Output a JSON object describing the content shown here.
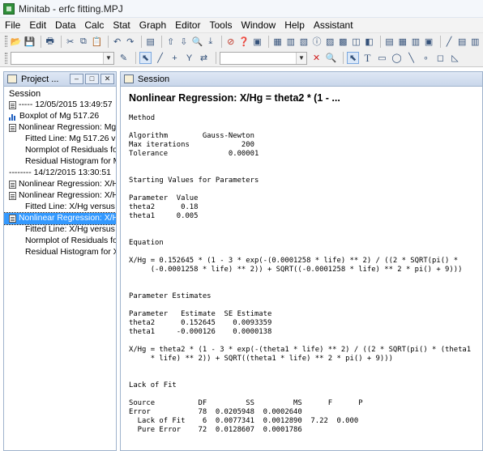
{
  "window": {
    "title": "Minitab - erfc fitting.MPJ"
  },
  "menu": [
    "File",
    "Edit",
    "Data",
    "Calc",
    "Stat",
    "Graph",
    "Editor",
    "Tools",
    "Window",
    "Help",
    "Assistant"
  ],
  "left_pane": {
    "title": "Project ...",
    "root": "Session",
    "items": [
      {
        "text": "----- 12/05/2015 13:49:57",
        "indent": 1,
        "icon": "doc"
      },
      {
        "text": "Boxplot of Mg 517.26",
        "indent": 1,
        "icon": "bar"
      },
      {
        "text": "Nonlinear Regression: Mg 5",
        "indent": 1,
        "icon": "doc"
      },
      {
        "text": "Fitted Line: Mg 517.26 ver",
        "indent": 2,
        "icon": ""
      },
      {
        "text": "Normplot of Residuals for",
        "indent": 2,
        "icon": ""
      },
      {
        "text": "Residual Histogram for M",
        "indent": 2,
        "icon": ""
      },
      {
        "text": "-------- 14/12/2015 13:30:51",
        "indent": 1,
        "icon": ""
      },
      {
        "text": "Nonlinear Regression: X/Hg",
        "indent": 1,
        "icon": "doc"
      },
      {
        "text": "Nonlinear Regression: X/Hg",
        "indent": 1,
        "icon": "doc"
      },
      {
        "text": "Fitted Line: X/Hg versus li",
        "indent": 2,
        "icon": ""
      },
      {
        "text": "Nonlinear Regression: X/Hg",
        "indent": 1,
        "icon": "doc",
        "selected": true
      },
      {
        "text": "Fitted Line: X/Hg versus li",
        "indent": 2,
        "icon": ""
      },
      {
        "text": "Normplot of Residuals for",
        "indent": 2,
        "icon": ""
      },
      {
        "text": "Residual Histogram for X/",
        "indent": 2,
        "icon": ""
      }
    ]
  },
  "session": {
    "title": "Session",
    "heading": "Nonlinear Regression: X/Hg = theta2 * (1 - ...",
    "blocks": [
      "Method",
      "",
      "Algorithm        Gauss-Newton\nMax iterations            200\nTolerance              0.00001",
      "",
      "",
      "Starting Values for Parameters",
      "",
      "Parameter  Value\ntheta2      0.18\ntheta1     0.005",
      "",
      "",
      "Equation",
      "",
      "X/Hg = 0.152645 * (1 - 3 * exp(-(0.0001258 * life) ** 2) / ((2 * SQRT(pi() *\n     (-0.0001258 * life) ** 2)) + SQRT((-0.0001258 * life) ** 2 * pi() + 9)))",
      "",
      "",
      "Parameter Estimates",
      "",
      "Parameter   Estimate  SE Estimate\ntheta2      0.152645    0.0093359\ntheta1     -0.000126    0.0000138",
      "",
      "X/Hg = theta2 * (1 - 3 * exp(-(theta1 * life) ** 2) / ((2 * SQRT(pi() * (theta1\n     * life) ** 2)) + SQRT((theta1 * life) ** 2 * pi() + 9)))",
      "",
      "",
      "Lack of Fit",
      "",
      "Source          DF         SS         MS      F      P\nError           78  0.0205948  0.0002640\n  Lack of Fit    6  0.0077341  0.0012890  7.22  0.000\n  Pure Error    72  0.0128607  0.0001786"
    ]
  }
}
